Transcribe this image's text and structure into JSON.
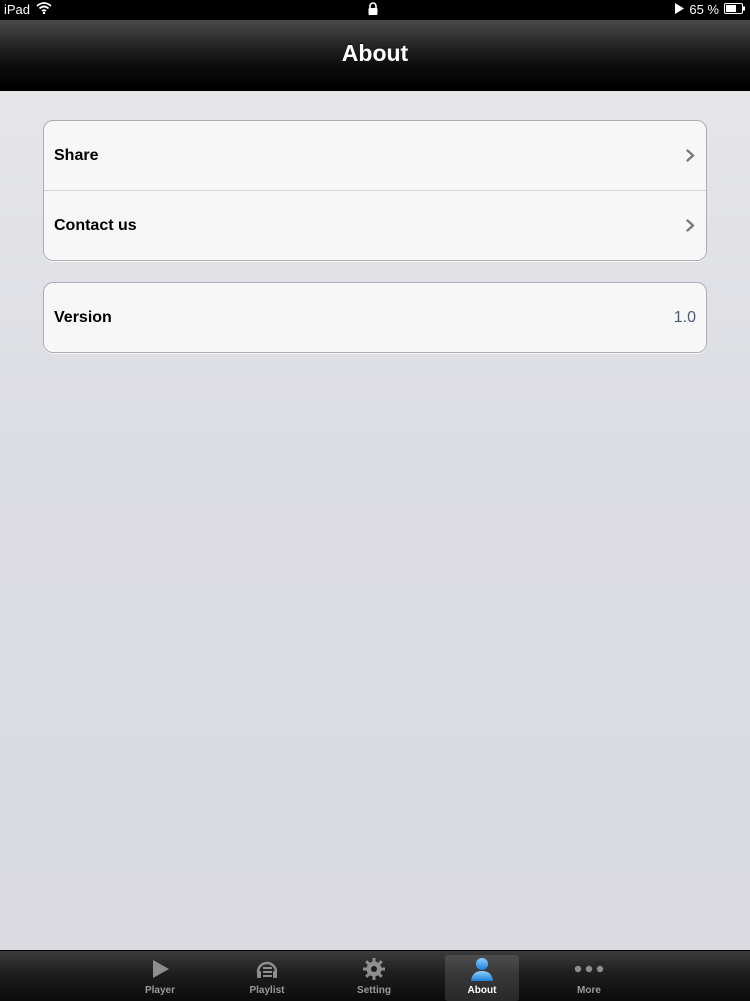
{
  "status_bar": {
    "device": "iPad",
    "battery": "65 %"
  },
  "nav": {
    "title": "About"
  },
  "groups": [
    {
      "rows": [
        {
          "label": "Share"
        },
        {
          "label": "Contact us"
        }
      ]
    },
    {
      "rows": [
        {
          "label": "Version",
          "value": "1.0"
        }
      ]
    }
  ],
  "tab_bar": {
    "tabs": [
      {
        "label": "Player",
        "icon": "play-icon"
      },
      {
        "label": "Playlist",
        "icon": "playlist-icon"
      },
      {
        "label": "Setting",
        "icon": "gear-icon"
      },
      {
        "label": "About",
        "icon": "person-icon",
        "active": true
      },
      {
        "label": "More",
        "icon": "more-icon"
      }
    ]
  },
  "colors": {
    "active_tab_icon": "#3b9ee8",
    "detail_value": "#4a5b7c"
  }
}
